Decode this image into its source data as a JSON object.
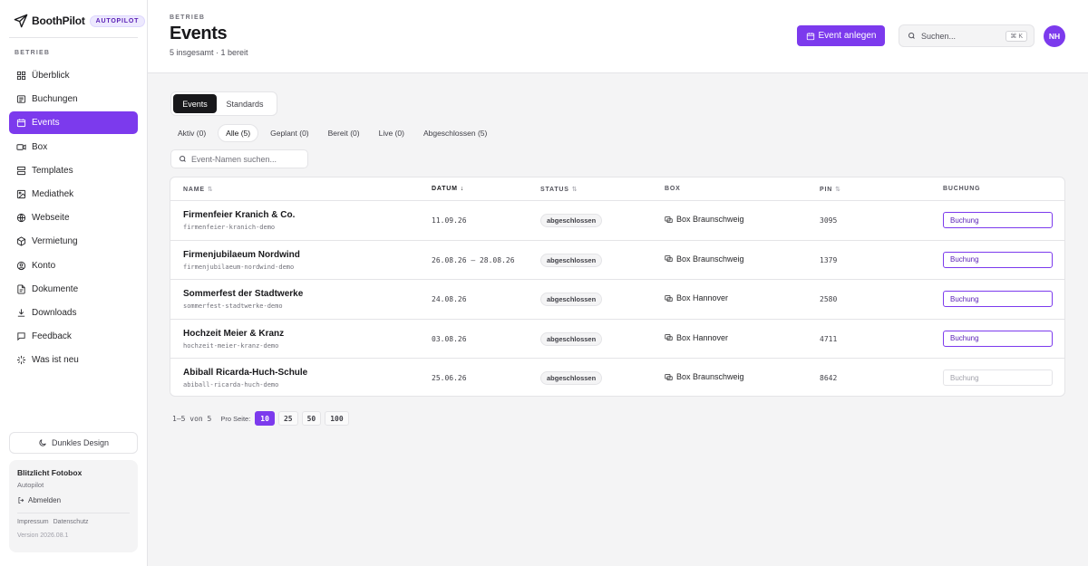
{
  "brand": {
    "name": "BoothPilot",
    "badge": "AUTOPILOT"
  },
  "sidebar": {
    "section": "BETRIEB",
    "items": [
      {
        "label": "Überblick",
        "icon": "grid-icon"
      },
      {
        "label": "Buchungen",
        "icon": "list-icon"
      },
      {
        "label": "Events",
        "icon": "calendar-icon",
        "active": true
      },
      {
        "label": "Box",
        "icon": "camera-icon"
      },
      {
        "label": "Templates",
        "icon": "layers-icon"
      },
      {
        "label": "Mediathek",
        "icon": "image-icon"
      },
      {
        "label": "Webseite",
        "icon": "globe-icon"
      },
      {
        "label": "Vermietung",
        "icon": "package-icon"
      },
      {
        "label": "Konto",
        "icon": "user-icon"
      },
      {
        "label": "Dokumente",
        "icon": "file-icon"
      },
      {
        "label": "Downloads",
        "icon": "download-icon"
      },
      {
        "label": "Feedback",
        "icon": "message-icon"
      },
      {
        "label": "Was ist neu",
        "icon": "sparkle-icon"
      }
    ],
    "dark_mode_label": "Dunkles Design",
    "account": {
      "name": "Blitzlicht Fotobox",
      "plan": "Autopilot",
      "logout_label": "Abmelden",
      "imprint_label": "Impressum",
      "privacy_label": "Datenschutz",
      "version": "Version 2026.08.1"
    }
  },
  "header": {
    "crumb": "BETRIEB",
    "title": "Events",
    "subtitle": "5 insgesamt · 1 bereit",
    "new_event_label": "Event anlegen",
    "search_placeholder": "Suchen...",
    "search_shortcut": "⌘ K",
    "avatar_initials": "NH"
  },
  "main": {
    "tabs": [
      {
        "label": "Events",
        "active": true
      },
      {
        "label": "Standards",
        "active": false
      }
    ],
    "filters": [
      {
        "label": "Aktiv (0)",
        "active": false
      },
      {
        "label": "Alle (5)",
        "active": true
      },
      {
        "label": "Geplant (0)",
        "active": false
      },
      {
        "label": "Bereit (0)",
        "active": false
      },
      {
        "label": "Live (0)",
        "active": false
      },
      {
        "label": "Abgeschlossen (5)",
        "active": false
      }
    ],
    "event_search_placeholder": "Event-Namen suchen...",
    "table": {
      "columns": [
        "NAME",
        "DATUM",
        "STATUS",
        "BOX",
        "PIN",
        "BUCHUNG"
      ],
      "sort_glyph": "⇅",
      "sorted_glyph": "↓",
      "rows": [
        {
          "name": "Firmenfeier Kranich & Co.",
          "slug": "firmenfeier-kranich-demo",
          "date": "11.09.26",
          "status": "abgeschlossen",
          "box": "Box Braunschweig",
          "pin": "3095",
          "booking": "Buchung",
          "booking_enabled": true
        },
        {
          "name": "Firmenjubilaeum Nordwind",
          "slug": "firmenjubilaeum-nordwind-demo",
          "date": "26.08.26 – 28.08.26",
          "status": "abgeschlossen",
          "box": "Box Braunschweig",
          "pin": "1379",
          "booking": "Buchung",
          "booking_enabled": true
        },
        {
          "name": "Sommerfest der Stadtwerke",
          "slug": "sommerfest-stadtwerke-demo",
          "date": "24.08.26",
          "status": "abgeschlossen",
          "box": "Box Hannover",
          "pin": "2580",
          "booking": "Buchung",
          "booking_enabled": true
        },
        {
          "name": "Hochzeit Meier & Kranz",
          "slug": "hochzeit-meier-kranz-demo",
          "date": "03.08.26",
          "status": "abgeschlossen",
          "box": "Box Hannover",
          "pin": "4711",
          "booking": "Buchung",
          "booking_enabled": true
        },
        {
          "name": "Abiball Ricarda-Huch-Schule",
          "slug": "abiball-ricarda-huch-demo",
          "date": "25.06.26",
          "status": "abgeschlossen",
          "box": "Box Braunschweig",
          "pin": "8642",
          "booking": "Buchung",
          "booking_enabled": false
        }
      ]
    },
    "pager": {
      "range": "1–5 von 5",
      "per_page_label": "Pro Seite:",
      "options": [
        "10",
        "25",
        "50",
        "100"
      ],
      "selected": "10"
    }
  },
  "colors": {
    "accent": "#7c3aed",
    "text": "#18181b",
    "border": "#e4e4e7"
  }
}
